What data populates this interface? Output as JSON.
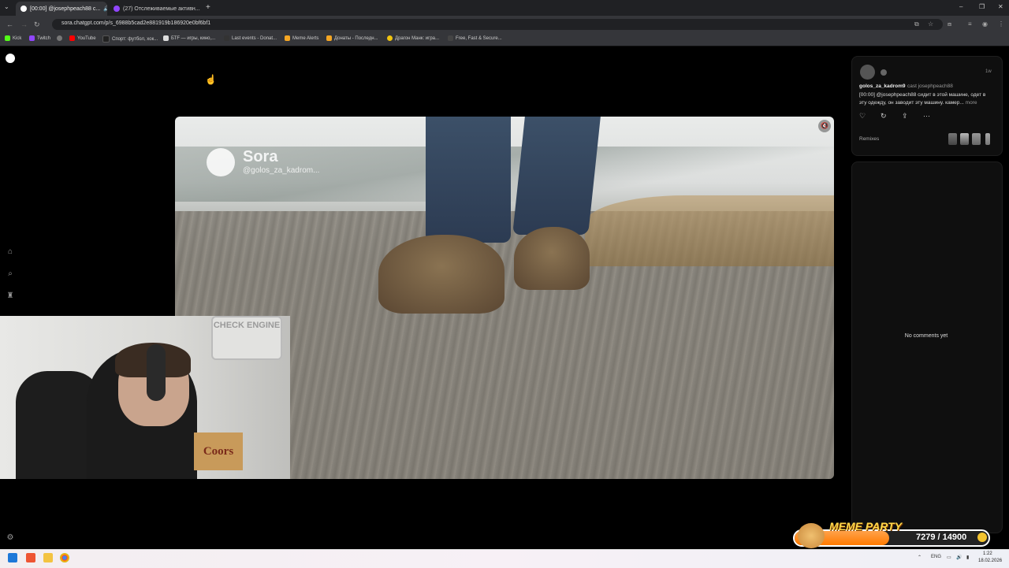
{
  "browser": {
    "tabs": [
      {
        "title": "[00:00] @josephpeach88 с...",
        "active": true
      },
      {
        "title": "(27) Отслеживаемые активн...",
        "active": false
      }
    ],
    "url": "sora.chatgpt.com/p/s_6988b5cad2e881919b186920e0bf6bf1",
    "bookmarks": [
      {
        "label": "Kick",
        "color": "#53fc18"
      },
      {
        "label": "Twitch",
        "color": "#9146ff"
      },
      {
        "label": "",
        "color": "#777777"
      },
      {
        "label": "YouTube",
        "color": "#ff0000"
      },
      {
        "label": "Спорт: футбол, хок...",
        "color": "#222222"
      },
      {
        "label": "БТF — игры, кино,...",
        "color": "#dddddd"
      },
      {
        "label": "Last events - Donat...",
        "color": "#333333"
      },
      {
        "label": "Meme Alerts",
        "color": "#f5a623"
      },
      {
        "label": "Донаты - Последн...",
        "color": "#f5a623"
      },
      {
        "label": "Драгон Манк: игра...",
        "color": "#f1c40f"
      },
      {
        "label": "Free, Fast & Secure...",
        "color": "#444444"
      }
    ]
  },
  "video": {
    "watermark_title": "Sora",
    "watermark_user": "@golos_za_kadrom..."
  },
  "post": {
    "username": "golos_za_kadrom9",
    "cast_text": "cast josephpeach88",
    "time": "1w",
    "text": "[00:00] @josephpeach88 сидит в этой машине, одет в эту одежду, он заводит эту машину. камер...",
    "more": "more",
    "remixes_label": "Remixes"
  },
  "comments": {
    "empty_text": "No comments yet"
  },
  "webcam": {
    "sign_text": "CHECK ENGINE",
    "box_text": "Coors"
  },
  "meme_party": {
    "title": "MEME PARTY",
    "current": "7279",
    "target": "14900",
    "count_text": "7279 / 14900",
    "progress": 0.489
  },
  "taskbar": {
    "lang": "ENG",
    "time": "1:22",
    "date": "18.02.2026"
  }
}
